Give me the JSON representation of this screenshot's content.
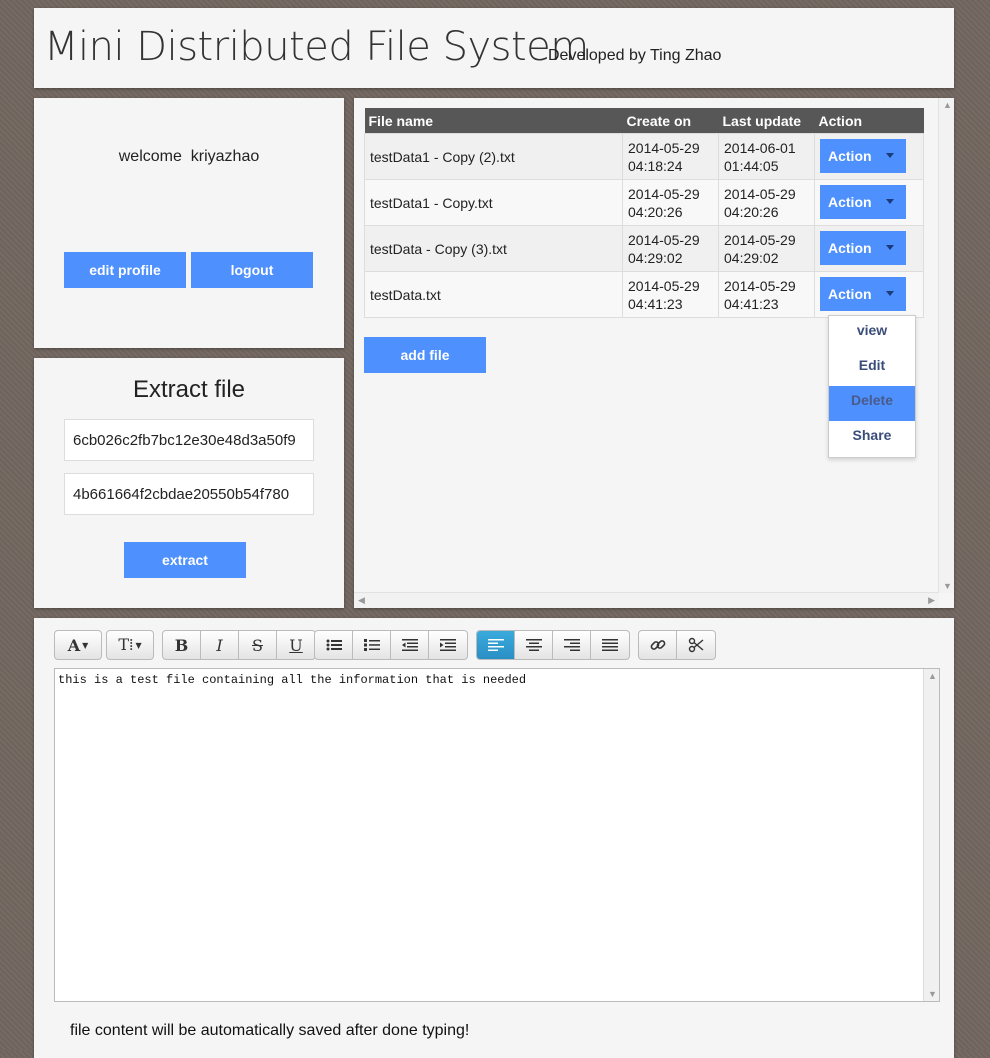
{
  "header": {
    "title": "Mini Distributed File System",
    "author": "Developed by Ting Zhao"
  },
  "user": {
    "welcome": "welcome  kriyazhao",
    "edit_profile": "edit profile",
    "logout": "logout"
  },
  "extract": {
    "title": "Extract file",
    "key1": "6cb026c2fb7bc12e30e48d3a50f9",
    "key2": "4b661664f2cbdae20550b54f780",
    "button": "extract"
  },
  "files": {
    "columns": [
      "File name",
      "Create on",
      "Last update",
      "Action"
    ],
    "rows": [
      {
        "name": "testData1 - Copy (2).txt",
        "created_date": "2014-05-29",
        "created_time": "04:18:24",
        "updated_date": "2014-06-01",
        "updated_time": "01:44:05",
        "action": "Action"
      },
      {
        "name": "testData1 - Copy.txt",
        "created_date": "2014-05-29",
        "created_time": "04:20:26",
        "updated_date": "2014-05-29",
        "updated_time": "04:20:26",
        "action": "Action"
      },
      {
        "name": "testData - Copy (3).txt",
        "created_date": "2014-05-29",
        "created_time": "04:29:02",
        "updated_date": "2014-05-29",
        "updated_time": "04:29:02",
        "action": "Action"
      },
      {
        "name": "testData.txt",
        "created_date": "2014-05-29",
        "created_time": "04:41:23",
        "updated_date": "2014-05-29",
        "updated_time": "04:41:23",
        "action": "Action"
      }
    ],
    "add_file": "add file",
    "dropdown": [
      "view",
      "Edit",
      "Delete",
      "Share"
    ],
    "dropdown_active": "Delete"
  },
  "editor": {
    "toolbar": {
      "font": "A",
      "font_size": "T⁞",
      "bold": "B",
      "italic": "I",
      "strike": "S",
      "underline": "U"
    },
    "content": "this is a test file containing all the information that is needed",
    "autosave_note": "file content will be automatically saved after done typing!"
  },
  "colors": {
    "accent": "#4d90fe",
    "table_header": "#575757",
    "active_tool": "#2a8fc4"
  }
}
